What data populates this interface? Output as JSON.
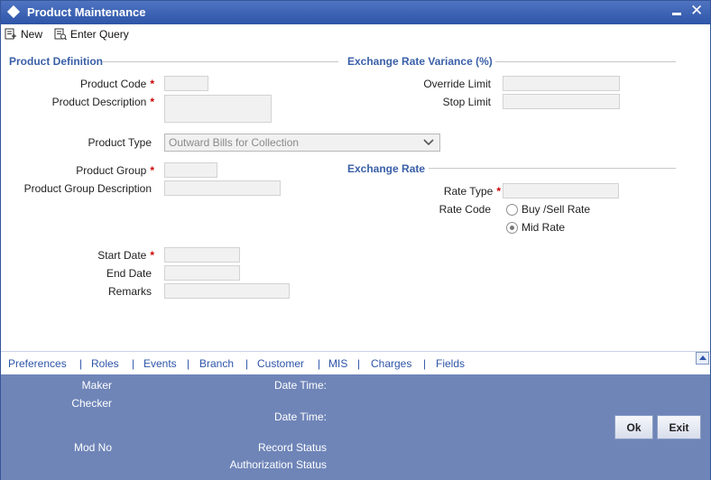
{
  "window": {
    "title": "Product Maintenance"
  },
  "toolbar": {
    "new_label": "New",
    "enter_query_label": "Enter Query"
  },
  "product_definition": {
    "section_title": "Product Definition",
    "product_code_label": "Product Code",
    "product_description_label": "Product Description",
    "product_type_label": "Product Type",
    "product_type_value": "Outward Bills for Collection",
    "product_group_label": "Product Group",
    "product_group_description_label": "Product Group Description",
    "start_date_label": "Start Date",
    "end_date_label": "End Date",
    "remarks_label": "Remarks",
    "required_marker": "*"
  },
  "exchange_rate_variance": {
    "section_title": "Exchange Rate Variance (%)",
    "override_limit_label": "Override Limit",
    "stop_limit_label": "Stop Limit"
  },
  "exchange_rate": {
    "section_title": "Exchange Rate",
    "rate_type_label": "Rate Type",
    "rate_code_label": "Rate Code",
    "rate_code_options": [
      {
        "label": "Buy /Sell Rate",
        "selected": false
      },
      {
        "label": "Mid Rate",
        "selected": true
      }
    ]
  },
  "tabs": [
    "Preferences",
    "Roles",
    "Events",
    "Branch",
    "Customer",
    "MIS",
    "Charges",
    "Fields"
  ],
  "footer": {
    "maker_label": "Maker",
    "checker_label": "Checker",
    "date_time_label": "Date Time:",
    "mod_no_label": "Mod No",
    "record_status_label": "Record Status",
    "authorization_status_label": "Authorization Status",
    "ok_label": "Ok",
    "exit_label": "Exit"
  },
  "colors": {
    "title_bar": "#2e55a8",
    "section_title": "#3a5fa8",
    "footer": "#6f85b8",
    "required": "#cc0000"
  }
}
